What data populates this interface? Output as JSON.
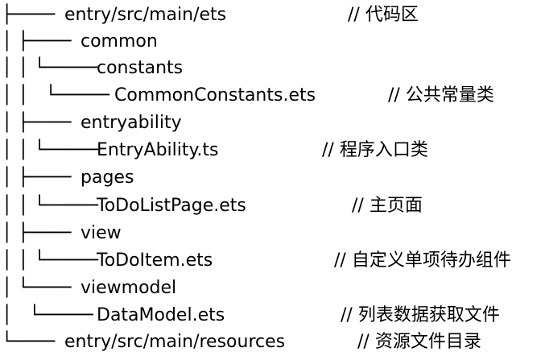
{
  "tree": {
    "rows": [
      {
        "connector": "├────",
        "name": "entry/src/main/ets",
        "comment": "// 代码区"
      },
      {
        "connector": "│ ├────",
        "name": "common",
        "comment": ""
      },
      {
        "connector": "│ │ └─────",
        "name": "constants",
        "comment": ""
      },
      {
        "connector": "│ │   └─────",
        "name": "CommonConstants.ets",
        "comment": "// 公共常量类"
      },
      {
        "connector": "│ ├────",
        "name": "entryability",
        "comment": ""
      },
      {
        "connector": "│ │ └─────",
        "name": "EntryAbility.ts",
        "comment": "// 程序入口类"
      },
      {
        "connector": "│ ├────",
        "name": "pages",
        "comment": ""
      },
      {
        "connector": "│ │ └─────",
        "name": "ToDoListPage.ets",
        "comment": "// 主页面"
      },
      {
        "connector": "│ ├────",
        "name": "view",
        "comment": ""
      },
      {
        "connector": "│ │ └─────",
        "name": "ToDoItem.ets",
        "comment": "// 自定义单项待办组件"
      },
      {
        "connector": "│ └────",
        "name": "viewmodel",
        "comment": ""
      },
      {
        "connector": "│   └─────",
        "name": "DataModel.ets",
        "comment": "// 列表数据获取文件"
      },
      {
        "connector": "└────",
        "name": "entry/src/main/resources",
        "comment": "// 资源文件目录"
      }
    ]
  }
}
